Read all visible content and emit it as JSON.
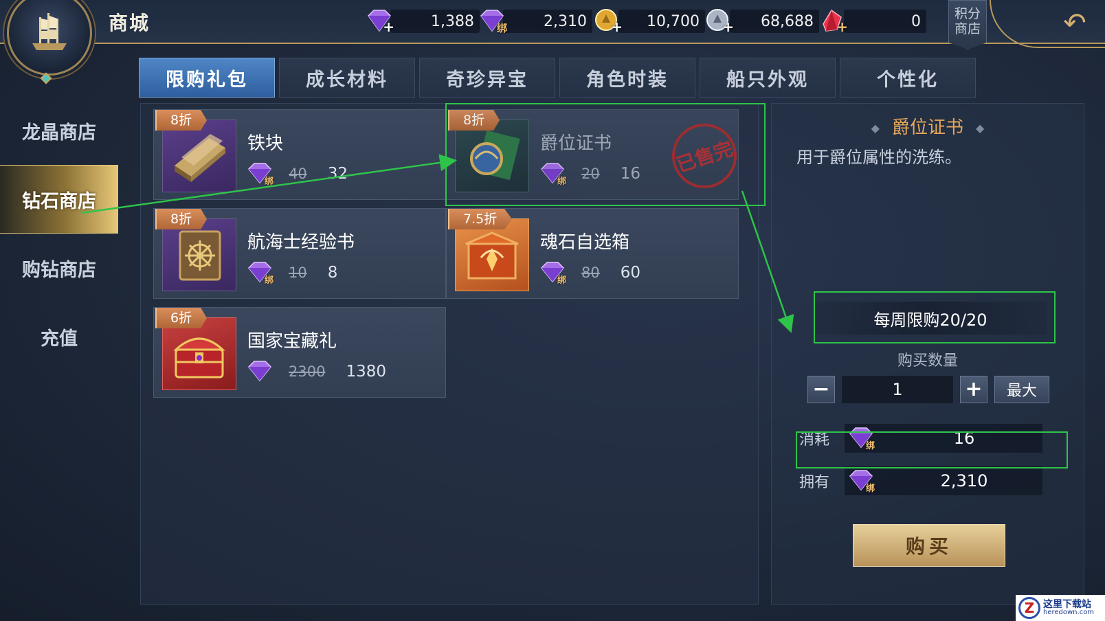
{
  "header": {
    "title": "商城",
    "points_shop": "积分\n商店",
    "currencies": [
      {
        "icon": "gem-icon",
        "amount": "1,388",
        "bound": false
      },
      {
        "icon": "bound-gem-icon",
        "amount": "2,310",
        "bound": true
      },
      {
        "icon": "gold-coin-icon",
        "amount": "10,700",
        "bound": false
      },
      {
        "icon": "silver-coin-icon",
        "amount": "68,688",
        "bound": false
      },
      {
        "icon": "red-crystal-icon",
        "amount": "0",
        "bound": false
      }
    ]
  },
  "leftnav": {
    "items": [
      {
        "label": "龙晶商店"
      },
      {
        "label": "钻石商店"
      },
      {
        "label": "购钻商店"
      },
      {
        "label": "充值"
      }
    ]
  },
  "tabs": [
    "限购礼包",
    "成长材料",
    "奇珍异宝",
    "角色时装",
    "船只外观",
    "个性化"
  ],
  "items": [
    {
      "badge": "8折",
      "name": "铁块",
      "old_price": "40",
      "price": "32",
      "bound": true,
      "sold_out": false
    },
    {
      "badge": "8折",
      "name": "爵位证书",
      "old_price": "20",
      "price": "16",
      "bound": true,
      "sold_out": true,
      "stamp": "已售完"
    },
    {
      "badge": "8折",
      "name": "航海士经验书",
      "old_price": "10",
      "price": "8",
      "bound": true,
      "sold_out": false
    },
    {
      "badge": "7.5折",
      "name": "魂石自选箱",
      "old_price": "80",
      "price": "60",
      "bound": true,
      "sold_out": false
    },
    {
      "badge": "6折",
      "name": "国家宝藏礼",
      "old_price": "2300",
      "price": "1380",
      "bound": false,
      "sold_out": false
    }
  ],
  "detail": {
    "title": "爵位证书",
    "description": "用于爵位属性的洗练。",
    "weekly_limit": "每周限购20/20",
    "quantity_label": "购买数量",
    "quantity": "1",
    "max_label": "最大",
    "cost_label": "消耗",
    "cost_value": "16",
    "owned_label": "拥有",
    "owned_value": "2,310",
    "buy_label": "购买",
    "bind_char": "绑"
  },
  "watermark": {
    "line1": "这里下载站",
    "line2": "heredown.com",
    "logo": "Z"
  },
  "colors": {
    "highlight": "#2ec44a",
    "accent": "#e6a85a",
    "active_tab": "#3f76b8",
    "gold": "#b89a5c"
  }
}
